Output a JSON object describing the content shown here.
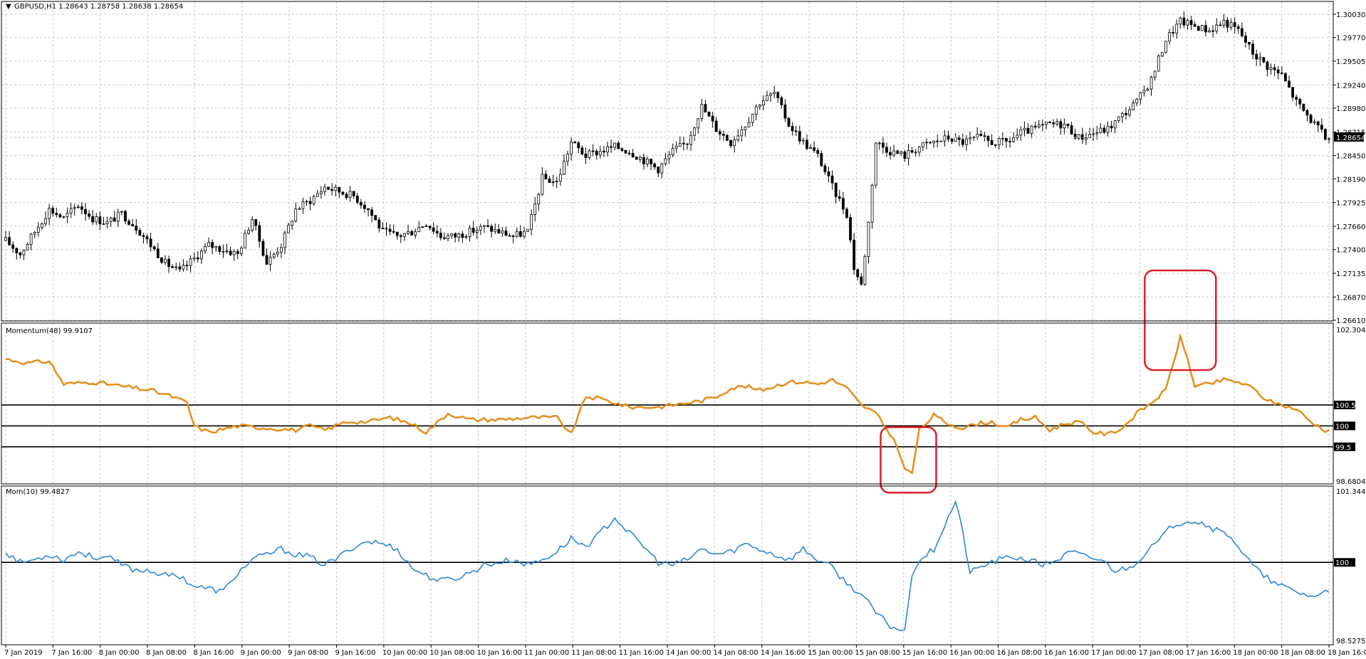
{
  "chart_data": [
    {
      "type": "candlestick",
      "title": "GBPUSD,H1  1.28643 1.28758 1.28638 1.28654",
      "symbol": "GBPUSD,H1",
      "ohlc_label": "1.28643 1.28758 1.28638 1.28654",
      "ylim": [
        1.2661,
        1.3003
      ],
      "y_ticks": [
        "1.30030",
        "1.29770",
        "1.29505",
        "1.29240",
        "1.28980",
        "1.28715",
        "1.28450",
        "1.28190",
        "1.27925",
        "1.27660",
        "1.27400",
        "1.27135",
        "1.26870",
        "1.26610"
      ],
      "current_price": "1.28654",
      "grid": true,
      "anchors": [
        [
          0,
          1.275
        ],
        [
          4,
          1.2735
        ],
        [
          8,
          1.276
        ],
        [
          12,
          1.2785
        ],
        [
          16,
          1.2775
        ],
        [
          20,
          1.279
        ],
        [
          24,
          1.2775
        ],
        [
          28,
          1.277
        ],
        [
          32,
          1.278
        ],
        [
          36,
          1.2765
        ],
        [
          40,
          1.2745
        ],
        [
          44,
          1.2725
        ],
        [
          48,
          1.2715
        ],
        [
          52,
          1.273
        ],
        [
          56,
          1.2745
        ],
        [
          60,
          1.274
        ],
        [
          64,
          1.2735
        ],
        [
          68,
          1.2775
        ],
        [
          72,
          1.2725
        ],
        [
          76,
          1.2745
        ],
        [
          80,
          1.2785
        ],
        [
          84,
          1.2795
        ],
        [
          88,
          1.281
        ],
        [
          92,
          1.2805
        ],
        [
          96,
          1.28
        ],
        [
          100,
          1.2785
        ],
        [
          104,
          1.276
        ],
        [
          108,
          1.2755
        ],
        [
          112,
          1.276
        ],
        [
          116,
          1.277
        ],
        [
          120,
          1.2755
        ],
        [
          124,
          1.2755
        ],
        [
          128,
          1.276
        ],
        [
          132,
          1.2765
        ],
        [
          136,
          1.276
        ],
        [
          140,
          1.2755
        ],
        [
          144,
          1.276
        ],
        [
          148,
          1.282
        ],
        [
          152,
          1.2815
        ],
        [
          156,
          1.286
        ],
        [
          160,
          1.2845
        ],
        [
          164,
          1.285
        ],
        [
          168,
          1.2855
        ],
        [
          172,
          1.285
        ],
        [
          176,
          1.284
        ],
        [
          180,
          1.283
        ],
        [
          184,
          1.285
        ],
        [
          188,
          1.286
        ],
        [
          192,
          1.29
        ],
        [
          196,
          1.2875
        ],
        [
          200,
          1.286
        ],
        [
          204,
          1.288
        ],
        [
          208,
          1.2905
        ],
        [
          212,
          1.2915
        ],
        [
          216,
          1.288
        ],
        [
          220,
          1.286
        ],
        [
          224,
          1.2845
        ],
        [
          228,
          1.281
        ],
        [
          232,
          1.278
        ],
        [
          234,
          1.272
        ],
        [
          236,
          1.27
        ],
        [
          238,
          1.277
        ],
        [
          240,
          1.286
        ],
        [
          244,
          1.285
        ],
        [
          248,
          1.2845
        ],
        [
          252,
          1.2855
        ],
        [
          256,
          1.286
        ],
        [
          260,
          1.2865
        ],
        [
          264,
          1.286
        ],
        [
          268,
          1.2865
        ],
        [
          272,
          1.286
        ],
        [
          276,
          1.286
        ],
        [
          280,
          1.287
        ],
        [
          284,
          1.2875
        ],
        [
          288,
          1.288
        ],
        [
          292,
          1.288
        ],
        [
          296,
          1.2865
        ],
        [
          300,
          1.287
        ],
        [
          304,
          1.2875
        ],
        [
          308,
          1.289
        ],
        [
          312,
          1.2905
        ],
        [
          316,
          1.293
        ],
        [
          320,
          1.2975
        ],
        [
          324,
          1.2995
        ],
        [
          328,
          1.299
        ],
        [
          332,
          1.2985
        ],
        [
          336,
          1.2995
        ],
        [
          340,
          1.2985
        ],
        [
          344,
          1.296
        ],
        [
          348,
          1.2945
        ],
        [
          352,
          1.2935
        ],
        [
          356,
          1.2905
        ],
        [
          360,
          1.2885
        ],
        [
          364,
          1.2865
        ]
      ]
    },
    {
      "type": "line",
      "title": "Momentum(48) 99.9107",
      "label": "Momentum(48) 99.9107",
      "ylim": [
        98.6804,
        102.3046
      ],
      "y_ticks": [
        "102.3046",
        "98.6804"
      ],
      "levels": [
        {
          "value": 100.5,
          "label": "100.5"
        },
        {
          "value": 100,
          "label": "100"
        },
        {
          "value": 99.5,
          "label": "99.5"
        }
      ],
      "color": "#e58e1a",
      "anchors": [
        [
          0,
          101.6
        ],
        [
          6,
          101.5
        ],
        [
          12,
          101.55
        ],
        [
          16,
          101.0
        ],
        [
          24,
          101.05
        ],
        [
          32,
          100.95
        ],
        [
          40,
          100.85
        ],
        [
          46,
          100.7
        ],
        [
          50,
          100.55
        ],
        [
          52,
          100.0
        ],
        [
          56,
          99.85
        ],
        [
          64,
          100.0
        ],
        [
          72,
          99.95
        ],
        [
          80,
          99.9
        ],
        [
          84,
          100.0
        ],
        [
          88,
          99.9
        ],
        [
          94,
          100.1
        ],
        [
          100,
          100.1
        ],
        [
          106,
          100.2
        ],
        [
          112,
          100.05
        ],
        [
          116,
          99.85
        ],
        [
          122,
          100.3
        ],
        [
          128,
          100.15
        ],
        [
          136,
          100.15
        ],
        [
          144,
          100.2
        ],
        [
          152,
          100.2
        ],
        [
          156,
          99.8
        ],
        [
          160,
          100.7
        ],
        [
          164,
          100.65
        ],
        [
          168,
          100.55
        ],
        [
          172,
          100.45
        ],
        [
          176,
          100.45
        ],
        [
          180,
          100.45
        ],
        [
          184,
          100.5
        ],
        [
          188,
          100.55
        ],
        [
          192,
          100.6
        ],
        [
          196,
          100.7
        ],
        [
          200,
          100.9
        ],
        [
          204,
          100.95
        ],
        [
          208,
          100.85
        ],
        [
          212,
          100.95
        ],
        [
          216,
          101.05
        ],
        [
          220,
          101.05
        ],
        [
          224,
          101.0
        ],
        [
          228,
          101.1
        ],
        [
          232,
          100.9
        ],
        [
          236,
          100.5
        ],
        [
          240,
          100.3
        ],
        [
          244,
          99.8
        ],
        [
          246,
          99.5
        ],
        [
          248,
          98.95
        ],
        [
          250,
          98.88
        ],
        [
          252,
          99.9
        ],
        [
          256,
          100.25
        ],
        [
          260,
          100.05
        ],
        [
          264,
          99.95
        ],
        [
          268,
          100.05
        ],
        [
          272,
          100.1
        ],
        [
          276,
          99.95
        ],
        [
          280,
          100.15
        ],
        [
          284,
          100.2
        ],
        [
          288,
          99.9
        ],
        [
          292,
          100.05
        ],
        [
          296,
          100.1
        ],
        [
          300,
          99.85
        ],
        [
          304,
          99.8
        ],
        [
          308,
          99.95
        ],
        [
          312,
          100.3
        ],
        [
          316,
          100.55
        ],
        [
          320,
          100.85
        ],
        [
          322,
          101.5
        ],
        [
          324,
          102.1
        ],
        [
          326,
          101.6
        ],
        [
          328,
          100.95
        ],
        [
          332,
          101.0
        ],
        [
          336,
          101.1
        ],
        [
          340,
          101.05
        ],
        [
          344,
          100.9
        ],
        [
          348,
          100.6
        ],
        [
          352,
          100.5
        ],
        [
          356,
          100.4
        ],
        [
          360,
          100.1
        ],
        [
          364,
          99.9
        ]
      ],
      "highlights": [
        {
          "center_index": 249,
          "kind": "trough"
        },
        {
          "center_index": 324,
          "kind": "peak"
        }
      ]
    },
    {
      "type": "line",
      "title": "Mom(10) 99.4827",
      "label": "Mom(10) 99.4827",
      "ylim": [
        98.5275,
        101.3444
      ],
      "y_ticks": [
        "101.3444",
        "100",
        "98.5275"
      ],
      "levels": [
        {
          "value": 100,
          "label": "100"
        }
      ],
      "color": "#2a88d8",
      "anchors": [
        [
          0,
          100.2
        ],
        [
          4,
          100.0
        ],
        [
          8,
          100.05
        ],
        [
          12,
          100.15
        ],
        [
          16,
          100.05
        ],
        [
          20,
          100.2
        ],
        [
          24,
          100.1
        ],
        [
          28,
          100.1
        ],
        [
          32,
          99.95
        ],
        [
          36,
          99.85
        ],
        [
          40,
          99.85
        ],
        [
          44,
          99.75
        ],
        [
          48,
          99.75
        ],
        [
          52,
          99.55
        ],
        [
          56,
          99.5
        ],
        [
          60,
          99.45
        ],
        [
          64,
          99.8
        ],
        [
          68,
          100.05
        ],
        [
          72,
          100.15
        ],
        [
          76,
          100.25
        ],
        [
          80,
          100.15
        ],
        [
          84,
          100.1
        ],
        [
          88,
          99.95
        ],
        [
          92,
          100.1
        ],
        [
          96,
          100.3
        ],
        [
          100,
          100.4
        ],
        [
          104,
          100.35
        ],
        [
          108,
          100.25
        ],
        [
          112,
          99.9
        ],
        [
          116,
          99.75
        ],
        [
          120,
          99.65
        ],
        [
          124,
          99.7
        ],
        [
          128,
          99.8
        ],
        [
          132,
          99.95
        ],
        [
          136,
          100.0
        ],
        [
          140,
          100.05
        ],
        [
          144,
          99.95
        ],
        [
          148,
          100.05
        ],
        [
          152,
          100.2
        ],
        [
          156,
          100.45
        ],
        [
          160,
          100.3
        ],
        [
          164,
          100.55
        ],
        [
          168,
          100.85
        ],
        [
          172,
          100.55
        ],
        [
          176,
          100.3
        ],
        [
          180,
          100.0
        ],
        [
          184,
          99.95
        ],
        [
          188,
          100.05
        ],
        [
          192,
          100.25
        ],
        [
          196,
          100.15
        ],
        [
          200,
          100.2
        ],
        [
          204,
          100.35
        ],
        [
          208,
          100.25
        ],
        [
          212,
          100.15
        ],
        [
          216,
          100.05
        ],
        [
          220,
          100.25
        ],
        [
          224,
          100.05
        ],
        [
          228,
          99.9
        ],
        [
          232,
          99.6
        ],
        [
          236,
          99.4
        ],
        [
          240,
          99.05
        ],
        [
          244,
          98.8
        ],
        [
          248,
          98.7
        ],
        [
          250,
          99.8
        ],
        [
          252,
          100.05
        ],
        [
          256,
          100.25
        ],
        [
          260,
          100.85
        ],
        [
          262,
          101.15
        ],
        [
          264,
          100.55
        ],
        [
          266,
          99.8
        ],
        [
          270,
          99.95
        ],
        [
          274,
          100.05
        ],
        [
          278,
          100.1
        ],
        [
          282,
          100.05
        ],
        [
          286,
          99.95
        ],
        [
          290,
          100.05
        ],
        [
          294,
          100.2
        ],
        [
          298,
          100.1
        ],
        [
          302,
          100.05
        ],
        [
          306,
          99.85
        ],
        [
          310,
          99.9
        ],
        [
          314,
          100.15
        ],
        [
          318,
          100.4
        ],
        [
          322,
          100.7
        ],
        [
          326,
          100.8
        ],
        [
          330,
          100.75
        ],
        [
          334,
          100.6
        ],
        [
          338,
          100.5
        ],
        [
          342,
          100.1
        ],
        [
          346,
          99.8
        ],
        [
          350,
          99.6
        ],
        [
          354,
          99.5
        ],
        [
          358,
          99.4
        ],
        [
          362,
          99.35
        ],
        [
          364,
          99.48
        ]
      ]
    }
  ],
  "x_axis": {
    "labels": [
      "7 Jan 2019",
      "7 Jan 16:00",
      "8 Jan 00:00",
      "8 Jan 08:00",
      "8 Jan 16:00",
      "9 Jan 00:00",
      "9 Jan 08:00",
      "9 Jan 16:00",
      "10 Jan 00:00",
      "10 Jan 08:00",
      "10 Jan 16:00",
      "11 Jan 00:00",
      "11 Jan 08:00",
      "11 Jan 16:00",
      "14 Jan 00:00",
      "14 Jan 08:00",
      "14 Jan 16:00",
      "15 Jan 00:00",
      "15 Jan 08:00",
      "15 Jan 16:00",
      "16 Jan 00:00",
      "16 Jan 08:00",
      "16 Jan 16:00",
      "17 Jan 00:00",
      "17 Jan 08:00",
      "17 Jan 16:00",
      "18 Jan 00:00",
      "18 Jan 08:00",
      "18 Jan 16:00"
    ],
    "bars": 366
  },
  "colors": {
    "background": "#ffffff",
    "candle_up": "#ffffff",
    "candle_down": "#000000",
    "momentum_line": "#e58e1a",
    "mom_line": "#2a88d8",
    "highlight_box": "#d9202a",
    "grid": "#c8c8c8"
  }
}
